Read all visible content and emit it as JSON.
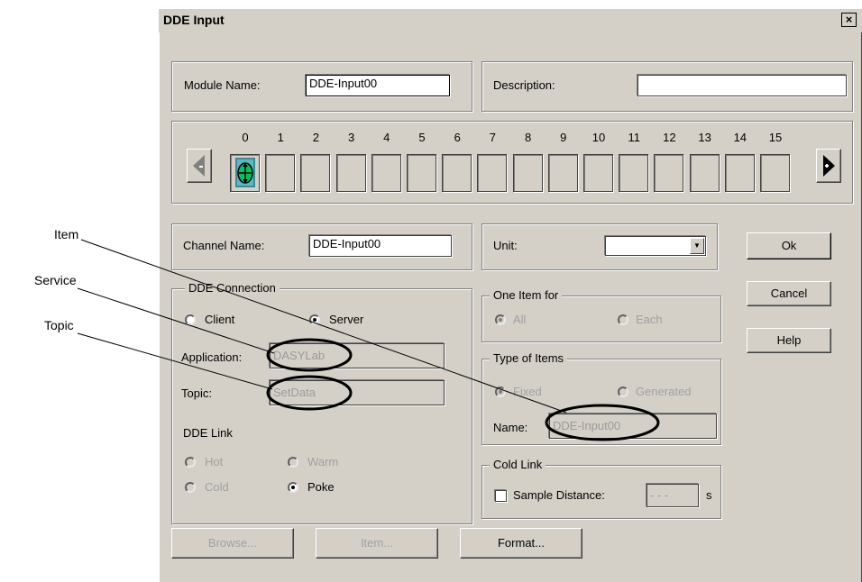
{
  "window": {
    "title": "DDE Input",
    "close_label": "×"
  },
  "module": {
    "name_label": "Module Name:",
    "name_value": "DDE-Input00",
    "description_label": "Description:",
    "description_value": ""
  },
  "channels": {
    "numbers": [
      "0",
      "1",
      "2",
      "3",
      "4",
      "5",
      "6",
      "7",
      "8",
      "9",
      "10",
      "11",
      "12",
      "13",
      "14",
      "15"
    ],
    "active_index": 0
  },
  "channel": {
    "name_label": "Channel Name:",
    "name_value": "DDE-Input00",
    "unit_label": "Unit:",
    "unit_value": ""
  },
  "dde_connection": {
    "legend": "DDE Connection",
    "client_label": "Client",
    "server_label": "Server",
    "application_label": "Application:",
    "application_value": "DASYLab",
    "topic_label": "Topic:",
    "topic_value": "SetData",
    "link_label": "DDE Link",
    "hot_label": "Hot",
    "warm_label": "Warm",
    "cold_label": "Cold",
    "poke_label": "Poke",
    "selected_mode": "Server",
    "selected_link": "Poke"
  },
  "one_item": {
    "legend": "One Item for",
    "all_label": "All",
    "each_label": "Each"
  },
  "type_items": {
    "legend": "Type of Items",
    "fixed_label": "Fixed",
    "generated_label": "Generated",
    "name_label": "Name:",
    "name_value": "DDE-Input00"
  },
  "cold_link": {
    "legend": "Cold Link",
    "sample_label": "Sample Distance:",
    "sample_value": "- - -",
    "unit": "s"
  },
  "buttons": {
    "ok": "Ok",
    "cancel": "Cancel",
    "help": "Help",
    "browse": "Browse...",
    "item": "Item...",
    "format": "Format..."
  },
  "annotations": {
    "item": "Item",
    "service": "Service",
    "topic": "Topic"
  },
  "colors": {
    "dialog_bg": "#d4d0c8",
    "channel_icon": "#00c060"
  }
}
